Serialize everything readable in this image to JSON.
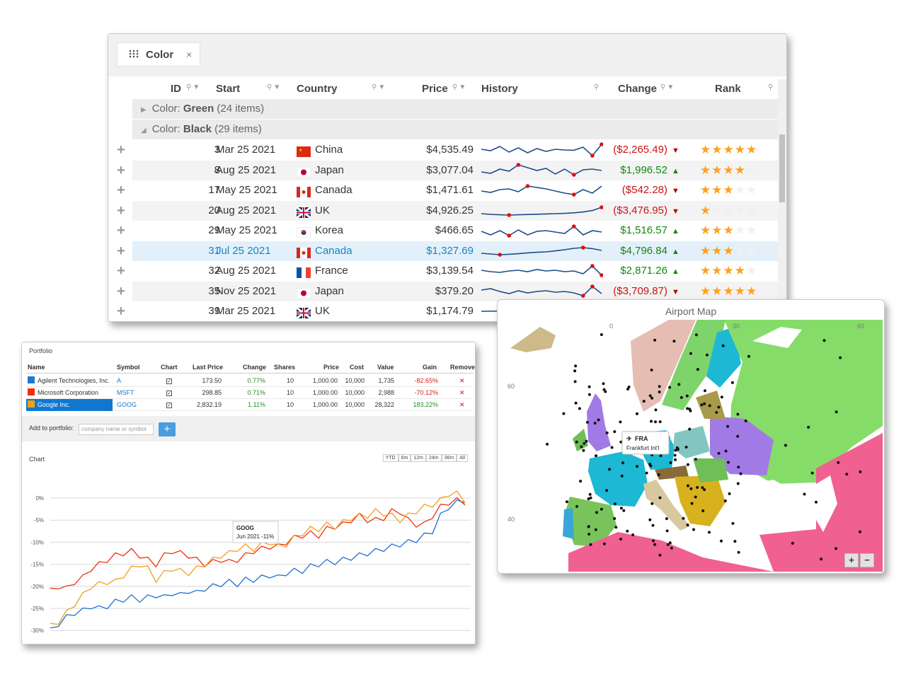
{
  "grid": {
    "group_chip": {
      "label": "Color",
      "close": "×"
    },
    "columns": {
      "id": "ID",
      "start": "Start",
      "country": "Country",
      "price": "Price",
      "history": "History",
      "change": "Change",
      "rank": "Rank"
    },
    "groups": [
      {
        "prefix": "Color: ",
        "name": "Green",
        "count": " (24 items)"
      },
      {
        "prefix": "Color: ",
        "name": "Black",
        "count": " (29 items)"
      }
    ],
    "rows": [
      {
        "id": "3",
        "start": "Mar 25 2021",
        "country": "China",
        "flag": "cn",
        "price": "$4,535.49",
        "change": "($2,265.49)",
        "dir": "down",
        "rank": 5,
        "spark": [
          0.55,
          0.45,
          0.75,
          0.35,
          0.65,
          0.3,
          0.6,
          0.4,
          0.55,
          0.5,
          0.48,
          0.7,
          0.1,
          0.9
        ]
      },
      {
        "id": "8",
        "start": "Aug 25 2021",
        "country": "Japan",
        "flag": "jp",
        "price": "$3,077.04",
        "change": "$1,996.52",
        "dir": "up",
        "rank": 4,
        "spark": [
          0.4,
          0.3,
          0.6,
          0.45,
          0.9,
          0.7,
          0.5,
          0.65,
          0.25,
          0.6,
          0.2,
          0.55,
          0.6,
          0.5
        ]
      },
      {
        "id": "17",
        "start": "May 25 2021",
        "country": "Canada",
        "flag": "ca",
        "price": "$1,471.61",
        "change": "($542.28)",
        "dir": "down",
        "rank": 3,
        "spark": [
          0.45,
          0.35,
          0.55,
          0.6,
          0.4,
          0.8,
          0.7,
          0.6,
          0.45,
          0.3,
          0.2,
          0.55,
          0.3,
          0.8
        ]
      },
      {
        "id": "20",
        "start": "Aug 25 2021",
        "country": "UK",
        "flag": "gb",
        "price": "$4,926.25",
        "change": "($3,476.95)",
        "dir": "down",
        "rank": 1,
        "spark": [
          0.3,
          0.25,
          0.22,
          0.2,
          0.22,
          0.24,
          0.26,
          0.28,
          0.3,
          0.32,
          0.36,
          0.42,
          0.52,
          0.75
        ]
      },
      {
        "id": "29",
        "start": "May 25 2021",
        "country": "Korea",
        "flag": "kr",
        "price": "$466.65",
        "change": "$1,516.57",
        "dir": "up",
        "rank": 3,
        "spark": [
          0.45,
          0.2,
          0.5,
          0.15,
          0.55,
          0.2,
          0.45,
          0.5,
          0.4,
          0.3,
          0.8,
          0.2,
          0.5,
          0.4
        ]
      },
      {
        "id": "31",
        "start": "Jul 25 2021",
        "country": "Canada",
        "flag": "ca",
        "price": "$1,327.69",
        "change": "$4,796.84",
        "dir": "up",
        "rank": 3,
        "spark": [
          0.35,
          0.3,
          0.25,
          0.28,
          0.32,
          0.38,
          0.42,
          0.45,
          0.52,
          0.6,
          0.7,
          0.75,
          0.68,
          0.55
        ]
      },
      {
        "id": "32",
        "start": "Aug 25 2021",
        "country": "France",
        "flag": "fr",
        "price": "$3,139.54",
        "change": "$2,871.26",
        "dir": "up",
        "rank": 4,
        "spark": [
          0.55,
          0.45,
          0.4,
          0.5,
          0.55,
          0.45,
          0.6,
          0.5,
          0.55,
          0.45,
          0.5,
          0.3,
          0.85,
          0.2
        ]
      },
      {
        "id": "35",
        "start": "Nov 25 2021",
        "country": "Japan",
        "flag": "jp",
        "price": "$379.20",
        "change": "($3,709.87)",
        "dir": "down",
        "rank": 5,
        "spark": [
          0.6,
          0.7,
          0.5,
          0.35,
          0.55,
          0.4,
          0.5,
          0.55,
          0.45,
          0.5,
          0.4,
          0.2,
          0.85,
          0.35
        ]
      },
      {
        "id": "39",
        "start": "Mar 25 2021",
        "country": "UK",
        "flag": "gb",
        "price": "$1,174.79",
        "change": "",
        "dir": "up",
        "rank": 0,
        "spark": [
          0.5,
          0.6
        ]
      }
    ],
    "selected_row": "31"
  },
  "portfolio": {
    "title": "Portfolio",
    "headers": {
      "name": "Name",
      "symbol": "Symbol",
      "chart": "Chart",
      "last": "Last Price",
      "change": "Change",
      "shares": "Shares",
      "price": "Price",
      "cost": "Cost",
      "value": "Value",
      "gain": "Gain",
      "remove": "Remove"
    },
    "rows": [
      {
        "name": "Agilent Technologies, Inc.",
        "symbol": "A",
        "color": "#1f77d0",
        "last": "173.50",
        "change": "0.77%",
        "shares": "10",
        "price": "1,000.00",
        "cost": "10,000",
        "value": "1,735",
        "gain": "-82.65%",
        "gaincolor": "#d02020"
      },
      {
        "name": "Microsoft Corporation",
        "symbol": "MSFT",
        "color": "#f03010",
        "last": "298.85",
        "change": "0.71%",
        "shares": "10",
        "price": "1,000.00",
        "cost": "10,000",
        "value": "2,988",
        "gain": "-70.12%",
        "gaincolor": "#d02020"
      },
      {
        "name": "Google Inc.",
        "symbol": "GOOG",
        "color": "#f8a010",
        "last": "2,832.19",
        "change": "1.11%",
        "shares": "10",
        "price": "1,000.00",
        "cost": "10,000",
        "value": "28,322",
        "gain": "183.22%",
        "gaincolor": "#209020"
      }
    ],
    "add_label": "Add to portfolio:",
    "add_placeholder": "company name or symbol",
    "add_button": "+",
    "remove_glyph": "✕",
    "chart_label": "Chart",
    "periods": [
      "YTD",
      "6m",
      "12m",
      "24m",
      "36m",
      "All"
    ],
    "tooltip": {
      "title": "GOOG",
      "text": "Jun 2021 -11%"
    }
  },
  "chart_data": {
    "type": "line",
    "title": "",
    "ylabel": "",
    "yticks": [
      "0%",
      "-5%",
      "-10%",
      "-15%",
      "-20%",
      "-25%",
      "-30%"
    ],
    "ylim": [
      -30,
      2
    ],
    "series": [
      {
        "name": "A",
        "color": "#1f6fd0",
        "values": [
          -30,
          -28.5,
          -27,
          -26,
          -25.5,
          -24.5,
          -25,
          -24.5,
          -23.5,
          -23,
          -22.5,
          -23,
          -22.5,
          -22,
          -22.5,
          -21.5,
          -22,
          -21,
          -21.5,
          -20.5,
          -20,
          -19.5,
          -19,
          -19.5,
          -18.5,
          -18.5,
          -18,
          -17.5,
          -18,
          -17,
          -16.5,
          -16.5,
          -15.5,
          -15,
          -14.5,
          -14.5,
          -14,
          -13.5,
          -13,
          -12.5,
          -12,
          -11.5,
          -11,
          -10.5,
          -10,
          -9.5,
          -8.5,
          -7.5,
          -4,
          -2,
          -1,
          -0.5
        ]
      },
      {
        "name": "MSFT",
        "color": "#f03010",
        "values": [
          -21,
          -20,
          -20.5,
          -19,
          -18,
          -16,
          -15,
          -14,
          -13,
          -12.5,
          -12,
          -13,
          -14,
          -15,
          -13,
          -12,
          -12.5,
          -13,
          -14,
          -15,
          -14.5,
          -14,
          -14.5,
          -14,
          -13,
          -12,
          -11.5,
          -11,
          -11,
          -10,
          -9,
          -8.5,
          -8,
          -8.5,
          -7,
          -6.5,
          -6,
          -5,
          -4,
          -5,
          -5,
          -4.5,
          -3,
          -3,
          -5,
          -6,
          -6,
          -4,
          -2,
          -1,
          -0.5,
          -1
        ]
      },
      {
        "name": "GOOG",
        "color": "#f0a020",
        "values": [
          -29,
          -28,
          -26,
          -24,
          -22,
          -20,
          -19.5,
          -19,
          -19,
          -17.5,
          -16,
          -15,
          -16,
          -18.5,
          -17,
          -16,
          -16.5,
          -17,
          -16,
          -15,
          -14,
          -13,
          -12.5,
          -11.5,
          -11,
          -11.5,
          -10.5,
          -10,
          -11,
          -10.5,
          -9,
          -8,
          -7,
          -7,
          -6,
          -6.5,
          -5.5,
          -4.5,
          -4,
          -4,
          -3,
          -3.5,
          -4,
          -5,
          -4,
          -3,
          -2,
          -1.5,
          -0.5,
          1,
          1,
          -0.5
        ]
      }
    ]
  },
  "map": {
    "title": "Airport Map",
    "lon_labels": [
      "0",
      "30",
      "60"
    ],
    "lat_labels": [
      "60",
      "40"
    ],
    "tooltip": {
      "code": "FRA",
      "name": "Frankfurt Int'l"
    },
    "zoom_in": "+",
    "zoom_out": "−"
  }
}
